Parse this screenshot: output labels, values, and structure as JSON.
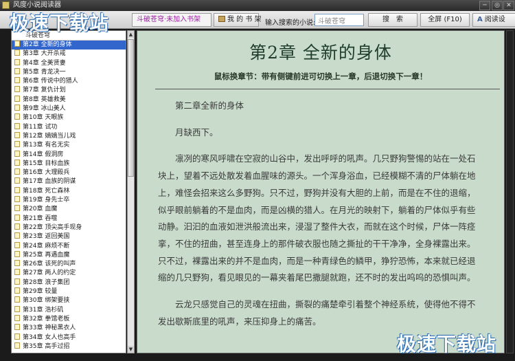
{
  "window": {
    "title": "风度小说阅读器",
    "watermark": "极速下载站",
    "buttons": [
      "─",
      "✕"
    ]
  },
  "toolbar": {
    "current_book": "斗破苍穹·未加入书架",
    "bookshelf_label": "我 的 书 架",
    "search_label": "输入搜索的小说:",
    "search_value": "斗破苍穹",
    "search_button": "搜　索",
    "fullscreen_button": "全屏 (F10)",
    "settings_button": "阅读设"
  },
  "sidebar": {
    "book_title": "斗破苍穹",
    "chapters": [
      "第2章 全新的身体",
      "第3章 大开杀戒",
      "第4章 全美贤妻",
      "第5章 青龙决一",
      "第6章 传说中的猎人",
      "第7章 复仇计划",
      "第8章 英雄救美",
      "第9章 冰山美人",
      "第10章 天眼族",
      "第11章 试功",
      "第12章 嫡嫡当儿戏",
      "第13章 有名无实",
      "第14章 假洞房",
      "第15章 目标血族",
      "第16章 大理殿兵",
      "第17章 血族的阴谋",
      "第18章 死亡森林",
      "第19章 身先士卒",
      "第20章 血魔",
      "第21章 吞噬",
      "第22章 顶尖高手现身",
      "第23章 返回美国",
      "第24章 麻烦不断",
      "第25章 再遇血魔",
      "第26章 该死的叫声",
      "第27章 两人的约定",
      "第28章 浪子集团",
      "第29章 较量",
      "第30章 绑架要挟",
      "第31章 浩杉矶",
      "第32章 拳馆老板",
      "第33章 神秘黑衣人",
      "第34章 女人也高手",
      "第35章 高手过招"
    ],
    "selected_index": 0
  },
  "reader": {
    "chapter_title": "第2章  全新的身体",
    "hint": "鼠标换章节：带有侧键前进可切换上一章，后退切换下一章！",
    "paragraphs": [
      "第二章全新的身体",
      "月缺西下。",
      "凛冽的寒风呼啸在空寂的山谷中，发出呼呼的吼声。几只野狗警惕的站在一处石块上，望着不远处散发着血腥味的源头。一个浑身浴血，已经模糊不清的尸体躺在地上，难怪会招来这么多野狗。只不过，野狗并没有大胆的上前，而是在不住的退缩，似乎眼前躺着的不是血肉，而是凶横的猎人。在月光的映射下，躺着的尸体似乎有些动静。汩汩的血液如泄洪般流出来，浸湿了整件大衣，而就在这个时候，尸体一阵痉挛，不住的扭曲，甚至连身上的那件破衣服也随之撕扯的干干净净，全身裸露出来。只不过，裸露出来的并不是血肉，而是一种青绿色的鳞甲，狰狞恐怖，本来就已经退缩的几只野狗，看见眼见的一幕夹着尾巴撒腿就跑，还不时的发出呜呜的恐惧叫声。",
      "云龙只感觉自己的灵魂在扭曲，撕裂的痛楚牵引着整个神经系统，使得他不得不发出歇斯底里的吼声，来压抑身上的痛苦。"
    ]
  },
  "colors": {
    "reader_bg": "#c9dccc",
    "selected_bg": "#3366cc",
    "current_book_text": "#9b1fa0"
  }
}
